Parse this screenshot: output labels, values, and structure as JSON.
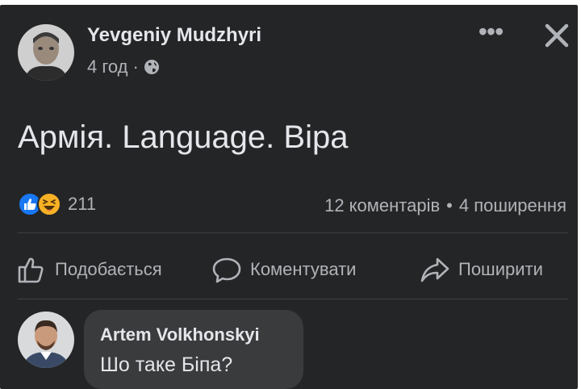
{
  "post": {
    "author": "Yevgeniy Mudzhyri",
    "time": "4 год",
    "meta_separator": "·",
    "audience_icon": "globe-icon",
    "text": "Армія. Language. Віра",
    "reactions": {
      "icons": [
        "like-icon",
        "haha-icon"
      ],
      "count": "211"
    },
    "comments_count": "12 коментарів",
    "stats_separator": "•",
    "shares_count": "4 поширення",
    "more_icon": "•••"
  },
  "actions": {
    "like": "Подобається",
    "comment": "Коментувати",
    "share": "Поширити"
  },
  "comment": {
    "author": "Artem Volkhonskyi",
    "text": "Шо таке Біпа?"
  },
  "colors": {
    "background": "#242526",
    "text_primary": "#e4e6eb",
    "text_secondary": "#b0b3b8",
    "comment_bubble": "#3a3b3c",
    "like_blue": "#1877f2",
    "haha_yellow": "#f7b125"
  }
}
